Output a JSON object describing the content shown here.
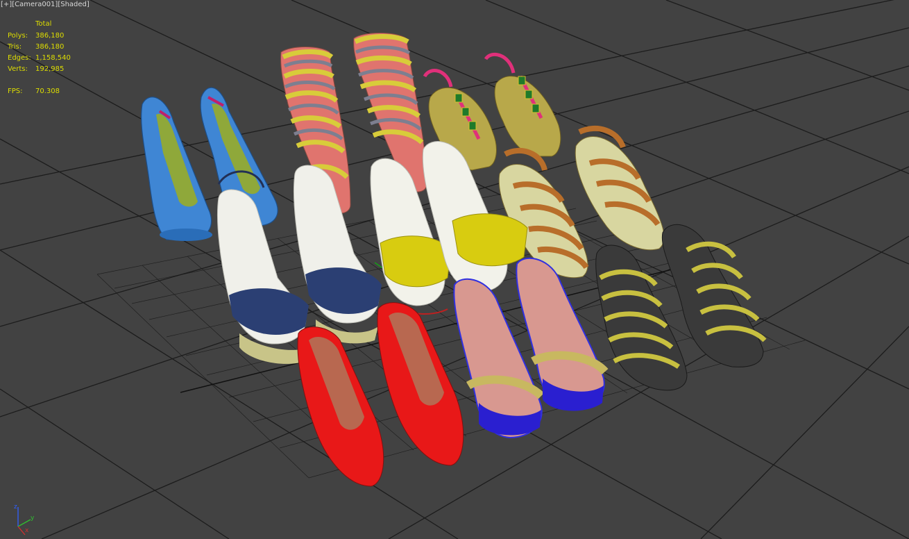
{
  "viewport": {
    "label_parts": [
      "[+]",
      "[Camera001]",
      "[Shaded]"
    ],
    "background_color": "#424242",
    "grid_color": "#1a1a1a"
  },
  "stats": {
    "header": "Total",
    "rows": [
      {
        "key": "Polys:",
        "value": "386,180"
      },
      {
        "key": "Tris:",
        "value": "386,180"
      },
      {
        "key": "Edges:",
        "value": "1,158,540"
      },
      {
        "key": "Verts:",
        "value": "192,985"
      }
    ],
    "fps_key": "FPS:",
    "fps_value": "70.308",
    "text_color": "#dede00"
  },
  "axis_gizmo": {
    "x_label": "x",
    "y_label": "y",
    "z_label": "z",
    "x_color": "#d03030",
    "y_color": "#30c030",
    "z_color": "#3060ff"
  },
  "models": [
    {
      "name": "blue-pump-pair",
      "color": "#4a90d9"
    },
    {
      "name": "gladiator-sandal-pair",
      "color": "#c8c060"
    },
    {
      "name": "pink-thong-sandal-pair",
      "color": "#e0307a"
    },
    {
      "name": "navy-platform-slingback-pair",
      "color": "#263a6b"
    },
    {
      "name": "yellow-mule-pair",
      "color": "#d8cc10"
    },
    {
      "name": "tan-wedge-sandal-pair",
      "color": "#c07830"
    },
    {
      "name": "red-pointed-pump-pair",
      "color": "#e01818"
    },
    {
      "name": "gold-blue-sandal-pair",
      "color": "#2a1fd0"
    },
    {
      "name": "black-strappy-sandal-pair",
      "color": "#3a3a3a"
    }
  ]
}
